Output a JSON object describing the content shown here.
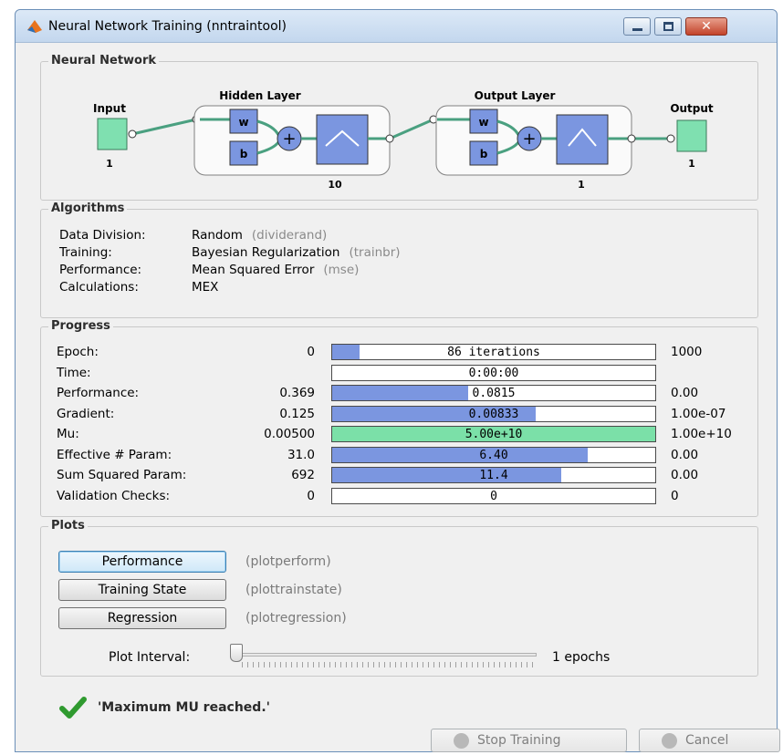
{
  "window": {
    "title": "Neural Network Training (nntraintool)",
    "accent": "#6b8fb8"
  },
  "network": {
    "section_title": "Neural Network",
    "input_label": "Input",
    "input_size": "1",
    "hidden_title": "Hidden Layer",
    "hidden_size": "10",
    "output_title": "Output Layer",
    "output_size": "1",
    "output_label": "Output",
    "output_out_size": "1",
    "weight_label": "w",
    "bias_label": "b",
    "sum_symbol": "+"
  },
  "algorithms": {
    "section_title": "Algorithms",
    "rows": [
      {
        "label": "Data Division:",
        "value": "Random",
        "fn": "(dividerand)"
      },
      {
        "label": "Training:",
        "value": "Bayesian Regularization",
        "fn": "(trainbr)"
      },
      {
        "label": "Performance:",
        "value": "Mean Squared Error",
        "fn": "(mse)"
      },
      {
        "label": "Calculations:",
        "value": "MEX",
        "fn": ""
      }
    ]
  },
  "progress": {
    "section_title": "Progress",
    "rows": [
      {
        "label": "Epoch:",
        "start": "0",
        "current": "86 iterations",
        "end": "1000",
        "fill": 0.086,
        "color": "#7b96e0"
      },
      {
        "label": "Time:",
        "start": "",
        "current": "0:00:00",
        "end": "",
        "fill": 0,
        "color": "#7b96e0"
      },
      {
        "label": "Performance:",
        "start": "0.369",
        "current": "0.0815",
        "end": "0.00",
        "fill": 0.42,
        "color": "#7b96e0"
      },
      {
        "label": "Gradient:",
        "start": "0.125",
        "current": "0.00833",
        "end": "1.00e-07",
        "fill": 0.63,
        "color": "#7b96e0"
      },
      {
        "label": "Mu:",
        "start": "0.00500",
        "current": "5.00e+10",
        "end": "1.00e+10",
        "fill": 1.0,
        "color": "#7be0a8"
      },
      {
        "label": "Effective # Param:",
        "start": "31.0",
        "current": "6.40",
        "end": "0.00",
        "fill": 0.79,
        "color": "#7b96e0"
      },
      {
        "label": "Sum Squared Param:",
        "start": "692",
        "current": "11.4",
        "end": "0.00",
        "fill": 0.71,
        "color": "#7b96e0"
      },
      {
        "label": "Validation Checks:",
        "start": "0",
        "current": "0",
        "end": "0",
        "fill": 0,
        "color": "#7b96e0"
      }
    ]
  },
  "plots": {
    "section_title": "Plots",
    "buttons": [
      {
        "label": "Performance",
        "fn": "(plotperform)"
      },
      {
        "label": "Training State",
        "fn": "(plottrainstate)"
      },
      {
        "label": "Regression",
        "fn": "(plotregression)"
      }
    ],
    "interval_label": "Plot Interval:",
    "interval_value": "1 epochs",
    "interval_level": 0
  },
  "status": {
    "message": "'Maximum MU reached.'"
  },
  "actions": {
    "stop_label": "Stop Training",
    "cancel_label": "Cancel"
  }
}
